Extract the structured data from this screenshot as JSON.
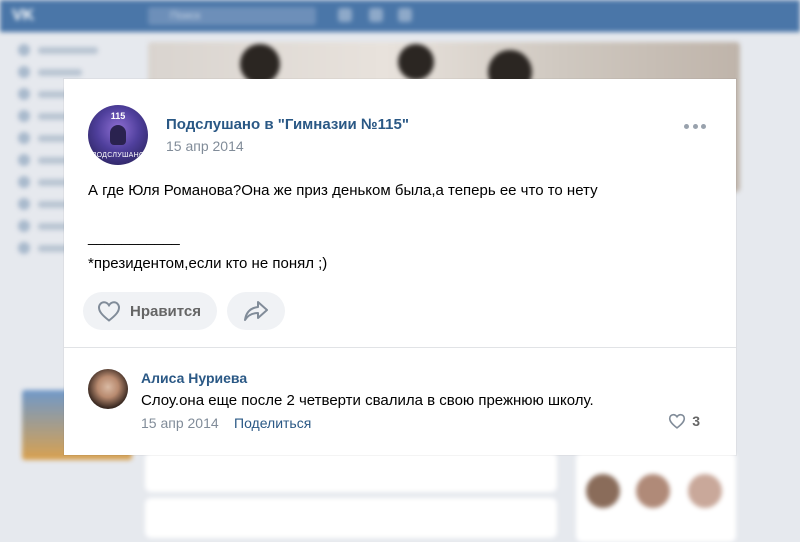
{
  "background": {
    "logo": "VK",
    "search_placeholder": "Поиск"
  },
  "post": {
    "group_name": "Подслушано в \"Гимназии №115\"",
    "date": "15 апр 2014",
    "avatar": {
      "number": "115",
      "caption": "ПОДСЛУШАНО"
    },
    "text_line1": "А где Юля Романова?Она же приз деньком была,а теперь ее что то нету",
    "text_line2": "___________",
    "text_line3": "*президентом,если кто не понял ;)",
    "like_label": "Нравится",
    "menu_icon": "more-horizontal-icon"
  },
  "comment": {
    "author": "Алиса Нуриева",
    "text": "Слоу.она еще после 2 четверти свалила в свою прежнюю школу.",
    "date": "15 апр 2014",
    "share_label": "Поделиться",
    "likes": "3"
  },
  "colors": {
    "link": "#2a5885",
    "muted": "#818c99",
    "header": "#4a76a8",
    "button_bg": "#f0f2f5"
  }
}
